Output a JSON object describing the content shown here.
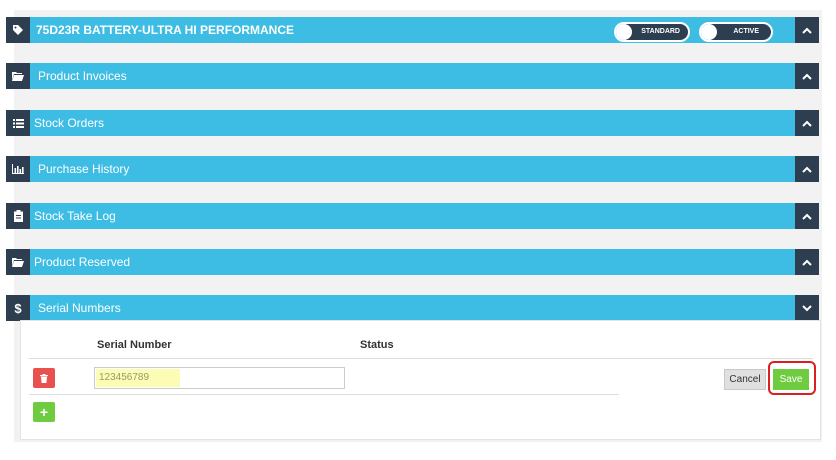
{
  "header": {
    "title": "75D23R BATTERY-ULTRA HI PERFORMANCE",
    "toggle_standard": "STANDARD",
    "toggle_active": "ACTIVE"
  },
  "sections": [
    {
      "id": "product-invoices",
      "label": "Product Invoices",
      "icon": "folder-open-icon"
    },
    {
      "id": "stock-orders",
      "label": "Stock Orders",
      "icon": "list-icon"
    },
    {
      "id": "purchase-history",
      "label": "Purchase History",
      "icon": "bar-chart-icon"
    },
    {
      "id": "stock-take-log",
      "label": "Stock Take Log",
      "icon": "clipboard-icon"
    },
    {
      "id": "product-reserved",
      "label": "Product Reserved",
      "icon": "folder-open-icon"
    },
    {
      "id": "serial-numbers",
      "label": "Serial Numbers",
      "icon": "dollar-icon"
    }
  ],
  "table": {
    "col_serial": "Serial Number",
    "col_status": "Status",
    "row": {
      "serial_value": "123456789"
    }
  },
  "buttons": {
    "cancel": "Cancel",
    "save": "Save"
  },
  "colors": {
    "bar": "#3dbde4",
    "dark": "#2c3e50",
    "delete": "#e8514f",
    "add": "#6fcb3f",
    "highlight": "#d9211f"
  }
}
